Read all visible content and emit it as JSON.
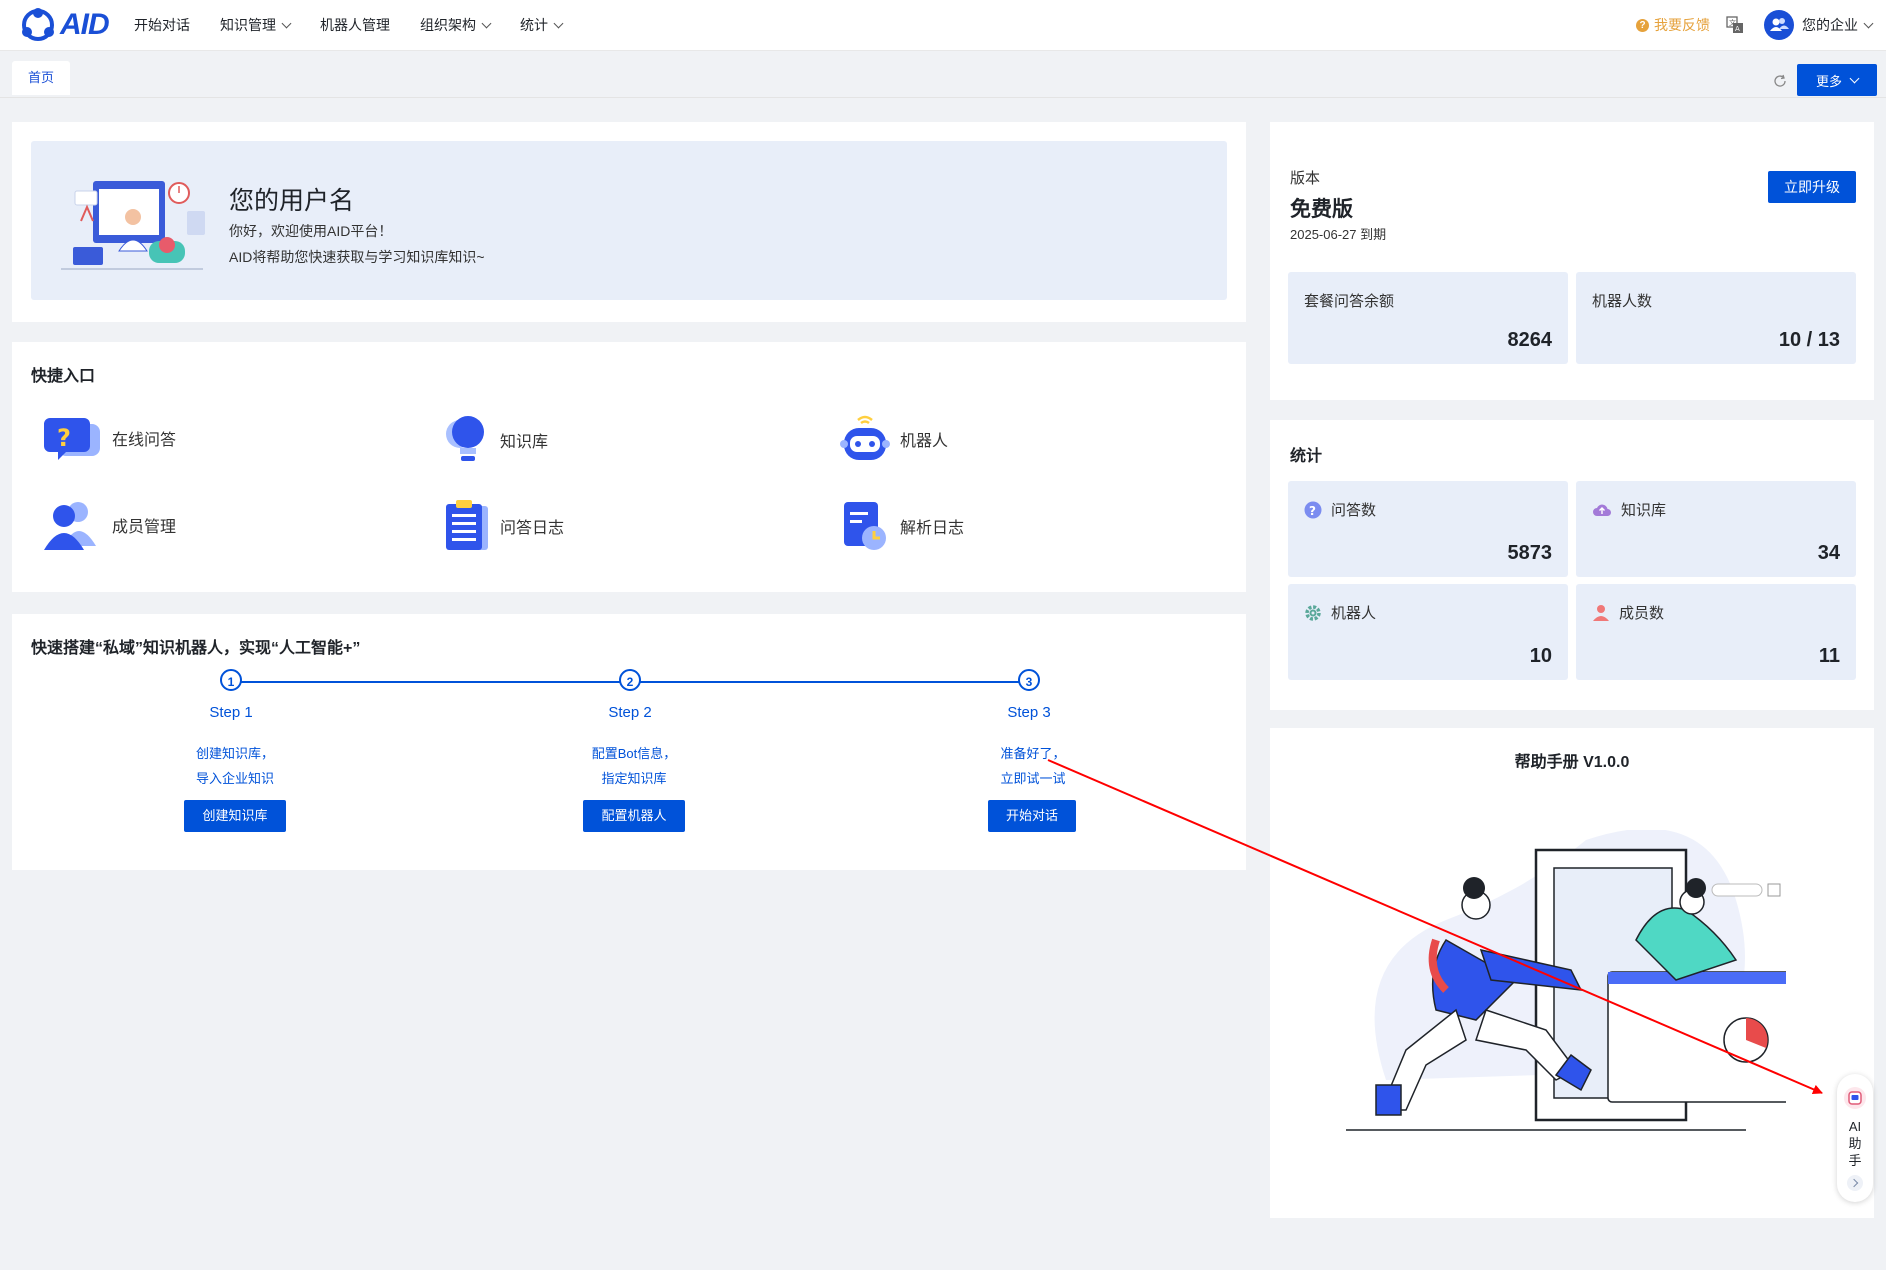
{
  "nav": {
    "logo": "AID",
    "items": [
      {
        "label": "开始对话",
        "dropdown": false
      },
      {
        "label": "知识管理",
        "dropdown": true
      },
      {
        "label": "机器人管理",
        "dropdown": false
      },
      {
        "label": "组织架构",
        "dropdown": true
      },
      {
        "label": "统计",
        "dropdown": true
      }
    ],
    "feedback": "我要反馈",
    "company": "您的企业"
  },
  "tabs": {
    "home": "首页",
    "more": "更多"
  },
  "welcome": {
    "username": "您的用户名",
    "line1": "你好，欢迎使用AID平台！",
    "line2": "AID将帮助您快速获取与学习知识库知识~"
  },
  "quick": {
    "title": "快捷入口",
    "items": [
      {
        "label": "在线问答",
        "icon": "question-bubble-icon"
      },
      {
        "label": "知识库",
        "icon": "lightbulb-icon"
      },
      {
        "label": "机器人",
        "icon": "robot-icon"
      },
      {
        "label": "成员管理",
        "icon": "users-icon"
      },
      {
        "label": "问答日志",
        "icon": "clipboard-list-icon"
      },
      {
        "label": "解析日志",
        "icon": "document-clock-icon"
      }
    ]
  },
  "steps": {
    "title": "快速搭建“私域”知识机器人，实现“人工智能+”",
    "items": [
      {
        "num": "1",
        "label": "Step 1",
        "desc1": "创建知识库，",
        "desc2": "导入企业知识",
        "button": "创建知识库"
      },
      {
        "num": "2",
        "label": "Step 2",
        "desc1": "配置Bot信息，",
        "desc2": "指定知识库",
        "button": "配置机器人"
      },
      {
        "num": "3",
        "label": "Step 3",
        "desc1": "准备好了，",
        "desc2": "立即试一试",
        "button": "开始对话"
      }
    ]
  },
  "version": {
    "label": "版本",
    "name": "免费版",
    "expire": "2025-06-27 到期",
    "upgrade": "立即升级",
    "cards": [
      {
        "name": "套餐问答余额",
        "value": "8264"
      },
      {
        "name": "机器人数",
        "value": "10 / 13"
      }
    ]
  },
  "stats": {
    "title": "统计",
    "cards": [
      {
        "name": "问答数",
        "value": "5873",
        "icon": "question-circle-icon"
      },
      {
        "name": "知识库",
        "value": "34",
        "icon": "cloud-upload-icon"
      },
      {
        "name": "机器人",
        "value": "10",
        "icon": "gear-icon"
      },
      {
        "name": "成员数",
        "value": "11",
        "icon": "person-icon"
      }
    ]
  },
  "help": {
    "title": "帮助手册 V1.0.0"
  },
  "ai_assistant": {
    "label": "AI助手"
  },
  "colors": {
    "primary": "#0052d9",
    "banner": "#e8eef9",
    "feedback": "#e6a23c",
    "annotation": "#ff0000"
  }
}
